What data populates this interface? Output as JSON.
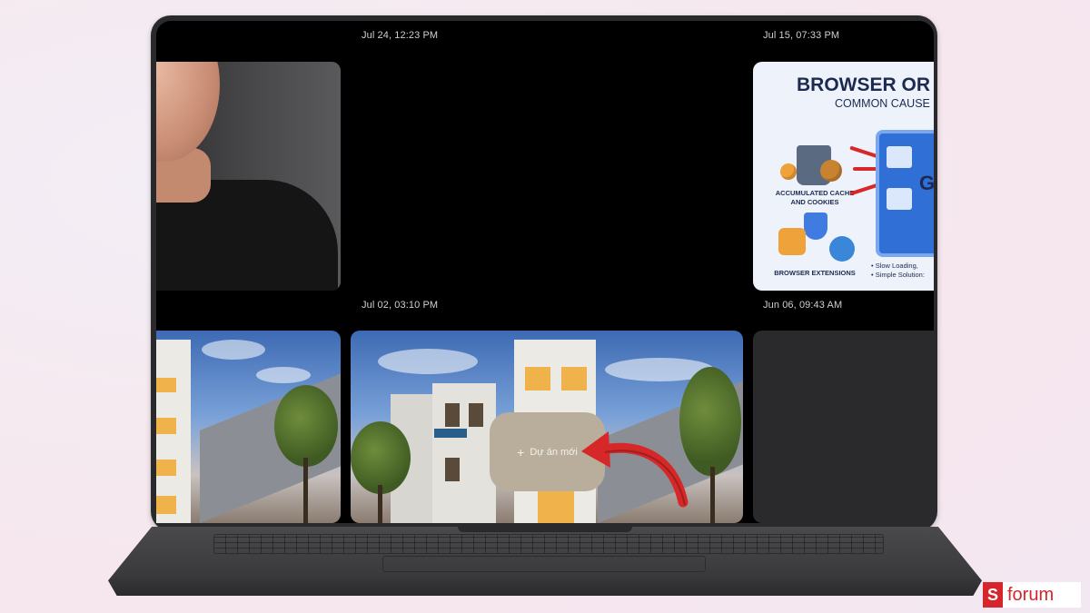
{
  "gallery": {
    "timestamps": [
      "Jul 24, 12:23 PM",
      "Jul 15, 07:33 PM",
      "Jul 02, 03:10 PM",
      "Jun 06, 09:43 AM"
    ],
    "infographic": {
      "title": "BROWSER OR",
      "subtitle": "COMMON CAUSE",
      "label_cache": "ACCUMULATED CACHE AND COOKIES",
      "label_ext": "BROWSER EXTENSIONS",
      "big_letter": "GE",
      "bullet_1": "• Slow Loading,",
      "bullet_2": "• Simple Solution:"
    },
    "new_project_label": "Dự án mới"
  },
  "brand": {
    "letter": "S",
    "name": "forum"
  },
  "colors": {
    "accent_red": "#d6262b",
    "screen_bg": "#000000",
    "popup_bg": "#b9ae9c"
  },
  "icons": [
    "plus-icon",
    "red-arrow-pointer"
  ]
}
